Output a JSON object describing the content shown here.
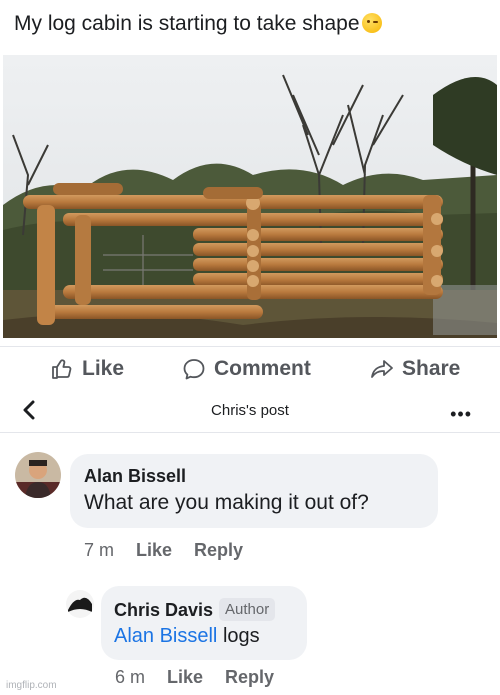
{
  "post": {
    "text": "My log cabin is starting to take shape",
    "emoji": "winking-face-emoji"
  },
  "actions": {
    "like": "Like",
    "comment": "Comment",
    "share": "Share"
  },
  "header": {
    "title": "Chris's post"
  },
  "comments": [
    {
      "author": "Alan Bissell",
      "text": "What are you making it out of?",
      "time": "7 m",
      "like": "Like",
      "reply": "Reply"
    },
    {
      "author": "Chris Davis",
      "badge": "Author",
      "mention": "Alan Bissell",
      "text": "logs",
      "time": "6 m",
      "like": "Like",
      "reply": "Reply"
    }
  ],
  "watermark": "imgflip.com",
  "colors": {
    "accent": "#1b74e4",
    "bubble": "#f0f2f5",
    "muted": "#65676b"
  }
}
